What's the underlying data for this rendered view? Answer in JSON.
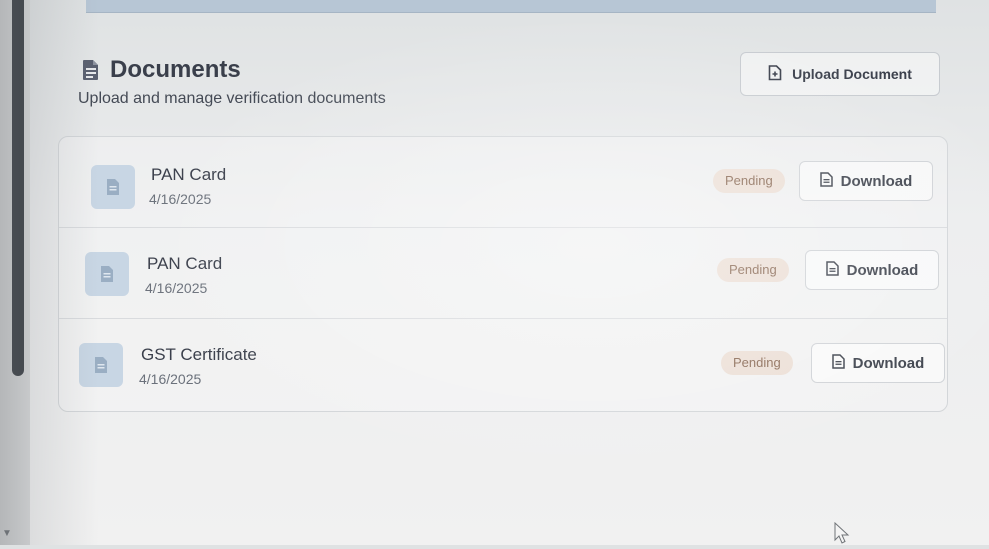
{
  "header": {
    "title": "Documents",
    "title_icon": "file-text-icon",
    "subtitle": "Upload and manage verification documents",
    "upload_label": "Upload Document",
    "upload_icon": "file-plus-icon"
  },
  "documents": [
    {
      "name": "PAN Card",
      "date": "4/16/2025",
      "status": "Pending",
      "action": "Download"
    },
    {
      "name": "PAN Card",
      "date": "4/16/2025",
      "status": "Pending",
      "action": "Download"
    },
    {
      "name": "GST Certificate",
      "date": "4/16/2025",
      "status": "Pending",
      "action": "Download"
    }
  ],
  "colors": {
    "badge_bg": "#ecdfd6",
    "badge_text": "#8a6a55",
    "doc_icon_bg": "#c8d6e4",
    "scrollbar": "#3a3e44"
  }
}
